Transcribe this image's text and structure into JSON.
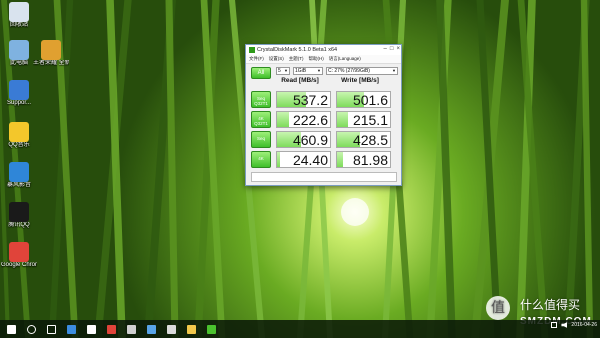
{
  "desktop": {
    "icons": [
      {
        "label": "回收站",
        "name": "recycle-bin-icon",
        "color": "#d9e3ee"
      },
      {
        "label": "此电脑",
        "name": "this-pc-icon",
        "color": "#7fb2e0"
      },
      {
        "label": "王者荣耀 全新剧情",
        "name": "game-shortcut-icon",
        "color": "#e0a030"
      },
      {
        "label": "Suppor...",
        "name": "support-icon",
        "color": "#3a7bd5"
      },
      {
        "label": "QQ音乐",
        "name": "qq-music-icon",
        "color": "#f3c72b"
      },
      {
        "label": "暴风影音",
        "name": "player-icon",
        "color": "#2f86d8"
      },
      {
        "label": "腾讯QQ",
        "name": "qq-icon",
        "color": "#1a1a1a"
      },
      {
        "label": "Google Chrome",
        "name": "chrome-icon",
        "color": "#e0443a"
      }
    ]
  },
  "cdm": {
    "title": "CrystalDiskMark 5.1.0 Beta1 x64",
    "menu": [
      "文件(F)",
      "设置(S)",
      "主题(T)",
      "帮助(H)",
      "语言(Language)"
    ],
    "all_label": "All",
    "count_value": "5",
    "size_value": "1GiB",
    "drive_value": "C: 27% (27/99GiB)",
    "read_header": "Read [MB/s]",
    "write_header": "Write [MB/s]",
    "rows": [
      {
        "label_top": "Seq",
        "label_bottom": "Q32T1",
        "read": "537.2",
        "write": "501.6",
        "read_frac": 0.54,
        "write_frac": 0.5
      },
      {
        "label_top": "4K",
        "label_bottom": "Q32T1",
        "read": "222.6",
        "write": "215.1",
        "read_frac": 0.22,
        "write_frac": 0.21
      },
      {
        "label_top": "Seq",
        "label_bottom": "",
        "read": "460.9",
        "write": "428.5",
        "read_frac": 0.46,
        "write_frac": 0.43
      },
      {
        "label_top": "4K",
        "label_bottom": "",
        "read": "24.40",
        "write": "81.98",
        "read_frac": 0.06,
        "write_frac": 0.12
      }
    ]
  },
  "watermark": {
    "glyph": "值",
    "line1": "什么值得买",
    "line2": "SMZDM.COM"
  },
  "taskbar": {
    "items": [
      {
        "name": "start-button-icon",
        "color": "#ffffff"
      },
      {
        "name": "cortana-icon",
        "color": "#ffffff"
      },
      {
        "name": "task-view-icon",
        "color": "#ffffff"
      },
      {
        "name": "edge-icon",
        "color": "#3d8de0"
      },
      {
        "name": "store-icon",
        "color": "#ffffff"
      },
      {
        "name": "chrome-taskbar-icon",
        "color": "#e0443a"
      },
      {
        "name": "app-icon-1",
        "color": "#d0d0d0"
      },
      {
        "name": "app-icon-2",
        "color": "#59a4e8"
      },
      {
        "name": "app-icon-3",
        "color": "#dcdcdc"
      },
      {
        "name": "explorer-icon",
        "color": "#f2c94c"
      },
      {
        "name": "crystaldiskmark-taskbar-icon",
        "color": "#4bc22e"
      }
    ],
    "date": "2016-04-26"
  }
}
